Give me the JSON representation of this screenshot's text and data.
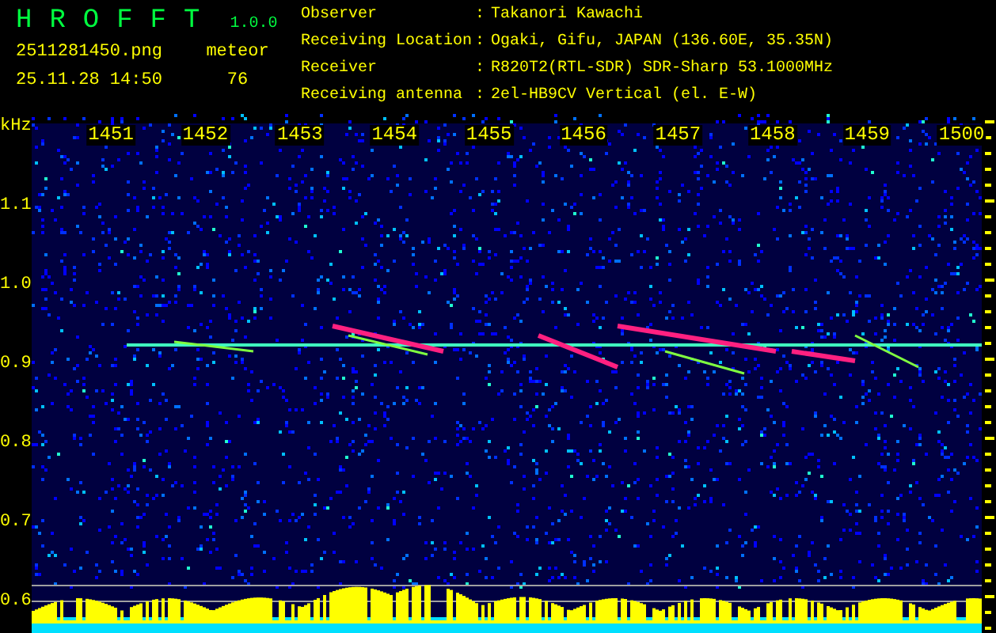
{
  "app": {
    "name": "HROFFT",
    "version": "1.0.0"
  },
  "file": {
    "name": "2511281450.png",
    "timestamp": "25.11.28 14:50"
  },
  "counter": {
    "label": "meteor",
    "value": "76"
  },
  "info": [
    {
      "label": "Observer",
      "separator": ":",
      "value": "Takanori Kawachi"
    },
    {
      "label": "Receiving Location",
      "separator": ":",
      "value": "Ogaki, Gifu, JAPAN (136.60E, 35.35N)"
    },
    {
      "label": "Receiver",
      "separator": ":",
      "value": "R820T2(RTL-SDR) SDR-Sharp 53.1000MHz"
    },
    {
      "label": "Receiving antenna",
      "separator": ":",
      "value": "2el-HB9CV Vertical (el. E-W)"
    }
  ],
  "spectrogram": {
    "freq_unit": "kHz",
    "time_labels": [
      "1451",
      "1452",
      "1453",
      "1454",
      "1455",
      "1456",
      "1457",
      "1458",
      "1459",
      "1500"
    ],
    "freq_labels": [
      "1.1",
      "1.0",
      "0.9",
      "0.8",
      "0.7",
      "0.6"
    ]
  }
}
